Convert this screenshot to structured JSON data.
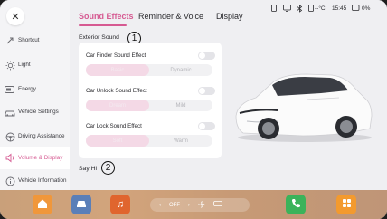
{
  "sidebar": {
    "items": [
      {
        "label": "Shortcut",
        "icon": "shortcut-icon"
      },
      {
        "label": "Light",
        "icon": "light-icon"
      },
      {
        "label": "Energy",
        "icon": "battery-icon"
      },
      {
        "label": "Vehicle Settings",
        "icon": "car-icon"
      },
      {
        "label": "Driving Assistance",
        "icon": "steering-wheel-icon"
      },
      {
        "label": "Volume & Display",
        "icon": "volume-icon"
      },
      {
        "label": "Vehicle Information",
        "icon": "info-icon"
      }
    ],
    "active_index": 5
  },
  "tabs": [
    {
      "label": "Sound Effects",
      "active": true
    },
    {
      "label": "Reminder & Voice",
      "active": false
    },
    {
      "label": "Display",
      "active": false
    }
  ],
  "status_bar": {
    "temperature": "--°C",
    "time": "15:45",
    "battery": "0%"
  },
  "exterior_sound": {
    "title": "Exterior Sound",
    "annotation": "1",
    "rows": [
      {
        "label": "Car Finder Sound Effect",
        "options": [
          "Basic",
          "Dynamic"
        ],
        "selected": 0,
        "enabled": false
      },
      {
        "label": "Car Unlock Sound Effect",
        "options": [
          "Dream",
          "Mild"
        ],
        "selected": 0,
        "enabled": false
      },
      {
        "label": "Car Lock Sound Effect",
        "options": [
          "Soft",
          "Warm"
        ],
        "selected": 0,
        "enabled": false
      }
    ]
  },
  "say_hi": {
    "title": "Say Hi",
    "annotation": "2"
  },
  "dock": {
    "climate_label": "OFF",
    "left_arrow": "‹",
    "right_arrow": "›"
  },
  "colors": {
    "accent": "#d65a92",
    "panel": "#efeff2",
    "card": "#ffffff"
  }
}
